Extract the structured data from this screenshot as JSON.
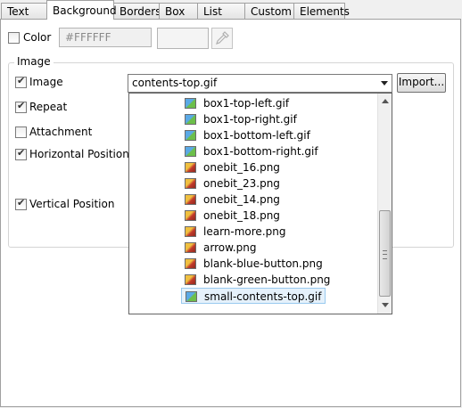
{
  "tabs": [
    {
      "label": "Text",
      "active": false
    },
    {
      "label": "Background",
      "active": true
    },
    {
      "label": "Borders",
      "active": false
    },
    {
      "label": "Box",
      "active": false
    },
    {
      "label": "List",
      "active": false
    },
    {
      "label": "Custom",
      "active": false
    },
    {
      "label": "Elements",
      "active": false
    }
  ],
  "color": {
    "label": "Color",
    "checked": false,
    "value": "#FFFFFF"
  },
  "image_group": {
    "title": "Image",
    "image_label": "Image",
    "image_checked": true,
    "selected_file": "contents-top.gif",
    "import_label": "Import...",
    "repeat_label": "Repeat",
    "repeat_checked": true,
    "attachment_label": "Attachment",
    "attachment_checked": false,
    "hpos_label": "Horizontal Position",
    "hpos_checked": true,
    "vpos_label": "Vertical Position",
    "vpos_checked": true
  },
  "dropdown": {
    "items": [
      {
        "name": "box1-top-left.gif",
        "icon": "gif-image-icon"
      },
      {
        "name": "box1-top-right.gif",
        "icon": "gif-image-icon"
      },
      {
        "name": "box1-bottom-left.gif",
        "icon": "gif-image-icon"
      },
      {
        "name": "box1-bottom-right.gif",
        "icon": "gif-image-icon"
      },
      {
        "name": "onebit_16.png",
        "icon": "png-image-icon"
      },
      {
        "name": "onebit_23.png",
        "icon": "png-image-icon"
      },
      {
        "name": "onebit_14.png",
        "icon": "png-image-icon"
      },
      {
        "name": "onebit_18.png",
        "icon": "png-image-icon"
      },
      {
        "name": "learn-more.png",
        "icon": "png-image-icon"
      },
      {
        "name": "arrow.png",
        "icon": "png-image-icon"
      },
      {
        "name": "blank-blue-button.png",
        "icon": "png-image-icon"
      },
      {
        "name": "blank-green-button.png",
        "icon": "png-image-icon"
      },
      {
        "name": "small-contents-top.gif",
        "icon": "gif-image-icon",
        "selected": true
      }
    ]
  }
}
